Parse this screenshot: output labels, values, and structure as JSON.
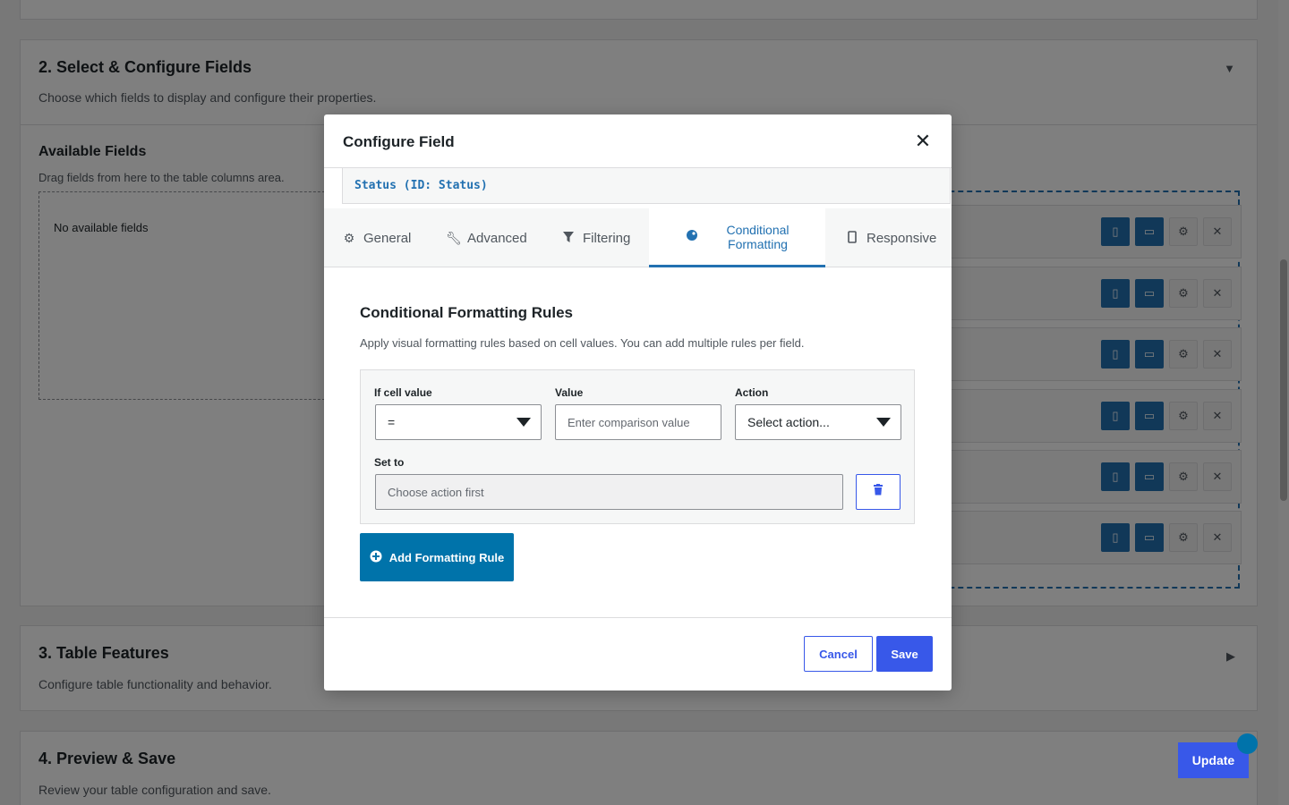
{
  "page": {
    "section2": {
      "title": "2. Select & Configure Fields",
      "description": "Choose which fields to display and configure their properties.",
      "toggle_icon": "triangle-down-icon",
      "available": {
        "title": "Available Fields",
        "description": "Drag fields from here to the table columns area.",
        "empty_text": "No available fields"
      },
      "column_rows_count": 6
    },
    "section3": {
      "title": "3. Table Features",
      "description": "Configure table functionality and behavior.",
      "toggle_icon": "triangle-right-icon"
    },
    "section4": {
      "title": "4. Preview & Save",
      "description": "Review your table configuration and save."
    },
    "update_label": "Update"
  },
  "modal": {
    "title": "Configure Field",
    "close_icon": "close-icon",
    "field_id": "Status (ID: Status)",
    "tabs": [
      {
        "label": "General",
        "icon": "gear-icon"
      },
      {
        "label": "Advanced",
        "icon": "wrench-icon"
      },
      {
        "label": "Filtering",
        "icon": "filter-icon"
      },
      {
        "label_line1": "Conditional",
        "label_line2": "Formatting",
        "icon": "color-palette-icon",
        "active": true
      },
      {
        "label": "Responsive",
        "icon": "mobile-icon"
      }
    ],
    "cf": {
      "title": "Conditional Formatting Rules",
      "description": "Apply visual formatting rules based on cell values. You can add multiple rules per field.",
      "rule": {
        "if_label": "If cell value",
        "operator_value": "=",
        "value_label": "Value",
        "value_placeholder": "Enter comparison value",
        "action_label": "Action",
        "action_value": "Select action...",
        "set_to_label": "Set to",
        "set_to_placeholder": "Choose action first"
      },
      "add_rule_label": "Add Formatting Rule"
    },
    "footer": {
      "cancel_label": "Cancel",
      "save_label": "Save"
    }
  },
  "colors": {
    "accent": "#3858e9",
    "wp_blue": "#2271b1",
    "add_rule_bg": "#0073aa"
  }
}
